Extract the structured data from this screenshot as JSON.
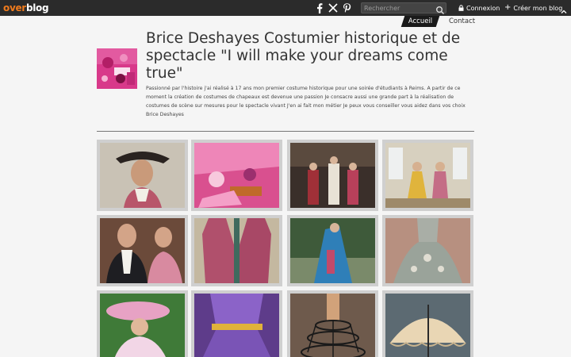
{
  "topbar": {
    "logo_part1": "over",
    "logo_part2": "blog",
    "social_icons": [
      "facebook-icon",
      "x-icon",
      "pinterest-icon"
    ],
    "search_placeholder": "Rechercher",
    "login_label": "Connexion",
    "create_label": "Créer mon blog",
    "colors": {
      "bar": "#2b2b2b",
      "logo_accent": "#f07b1d"
    }
  },
  "nav": {
    "items": [
      {
        "label": "Accueil",
        "active": true
      },
      {
        "label": "Contact",
        "active": false
      }
    ]
  },
  "blog": {
    "title": "Brice Deshayes Costumier historique et de spectacle \"I will make your dreams come true\"",
    "description": "Passionné par l'histoire j'ai réalisé à 17 ans mon premier costume historique pour une soirée d'étudiants à Reims. A partir de ce moment la création de costumes de chapeaux est devenue une passion Je consacre aussi une grande part à la réalisation de costumes de scène sur mesures pour le spectacle vivant J'en ai fait mon métier Je peux vous conseiller vous aidez dans vos choix Brice Deshayes"
  },
  "gallery": {
    "photos": [
      "photo-man-in-tricorn-hat",
      "photo-pink-fabrics-and-trims",
      "photo-costumed-group-in-hall",
      "photo-couple-in-ballroom",
      "photo-man-in-white-cravat",
      "photo-pink-brocade-waistcoat",
      "photo-blue-cloaked-figure",
      "photo-ornate-grey-gown",
      "photo-lady-in-pink-hat",
      "photo-purple-gown-gold-sash",
      "photo-crinoline-frame",
      "photo-lace-parasol"
    ]
  }
}
